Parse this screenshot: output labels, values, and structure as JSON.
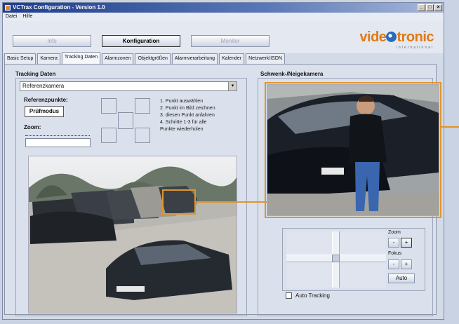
{
  "window": {
    "title": "VCTrax Configuration - Version 1.0"
  },
  "menu": [
    "Datei",
    "Hilfe"
  ],
  "modes": [
    {
      "label": "Info",
      "active": false
    },
    {
      "label": "Konfiguration",
      "active": true
    },
    {
      "label": "Monitor",
      "active": false
    }
  ],
  "logo": {
    "text_left": "vide",
    "text_right": "tronic",
    "sub": "international"
  },
  "tabs": [
    "Basic Setup",
    "Kamera",
    "Tracking Daten",
    "Alarmzonen",
    "Objektgrößen",
    "Alarmverarbeitung",
    "Kalender",
    "Netzwerk/ISDN"
  ],
  "left": {
    "title": "Tracking Daten",
    "camera_select": "Referenzkamera",
    "ref_points_label": "Referenzpunkte:",
    "test_button": "Prüfmodus",
    "zoom_label": "Zoom:",
    "steps": [
      "1. Punkt auswählen",
      "2. Punkt im Bild zeichnen",
      "3. diesen Punkt anfahren",
      "4. Schritte 1-3 für alle",
      "Punkte wiederholen"
    ]
  },
  "right": {
    "title": "Schwenk-/Neigekamera",
    "zoom_label": "Zoom",
    "focus_label": "Fokus",
    "auto_button": "Auto",
    "auto_tracking": "Auto Tracking",
    "minus": "-",
    "plus": "+"
  },
  "colors": {
    "accent": "#e0952a",
    "titlebar": "#1f3d8a"
  }
}
